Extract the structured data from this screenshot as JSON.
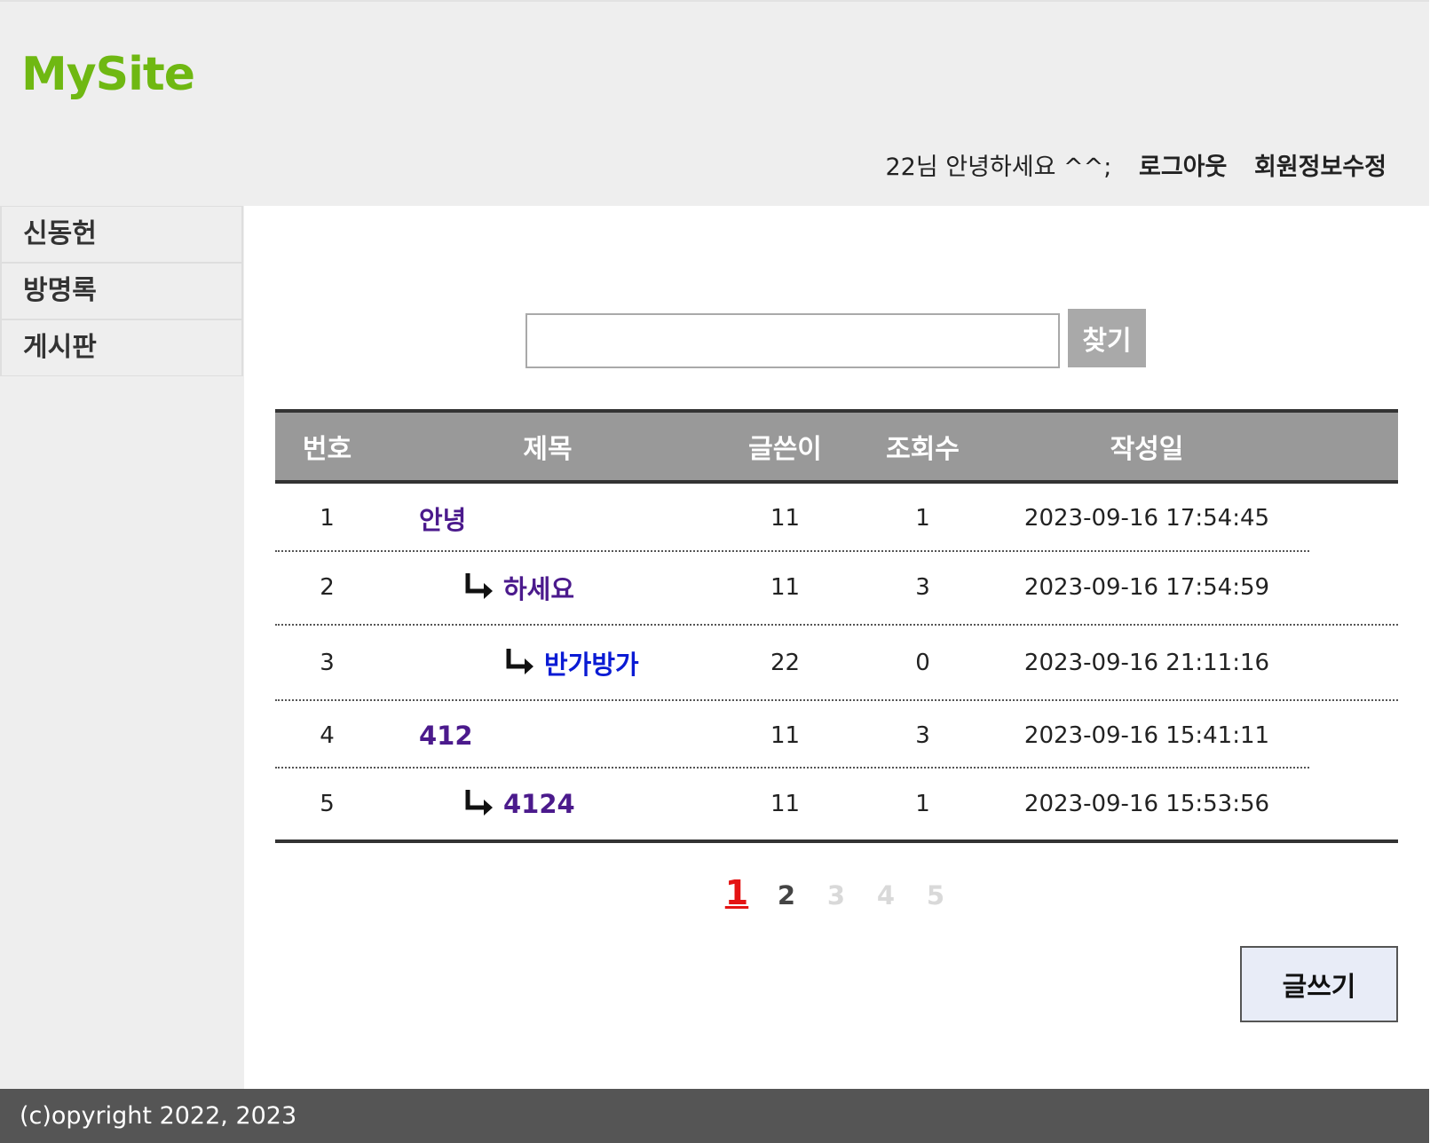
{
  "header": {
    "logo": "MySite",
    "greeting": "22님 안녕하세요 ^^;",
    "logout_label": "로그아웃",
    "edit_profile_label": "회원정보수정"
  },
  "sidebar": {
    "items": [
      {
        "label": "신동헌"
      },
      {
        "label": "방명록"
      },
      {
        "label": "게시판"
      }
    ]
  },
  "search": {
    "value": "",
    "button_label": "찾기"
  },
  "board": {
    "columns": [
      "번호",
      "제목",
      "글쓴이",
      "조회수",
      "작성일"
    ],
    "rows": [
      {
        "no": "1",
        "title": "안녕",
        "depth": 0,
        "writer": "11",
        "hits": "1",
        "date": "2023-09-16 17:54:45",
        "visited": true
      },
      {
        "no": "2",
        "title": "하세요",
        "depth": 1,
        "writer": "11",
        "hits": "3",
        "date": "2023-09-16 17:54:59",
        "visited": true
      },
      {
        "no": "3",
        "title": "반가방가",
        "depth": 2,
        "writer": "22",
        "hits": "0",
        "date": "2023-09-16 21:11:16",
        "visited": false
      },
      {
        "no": "4",
        "title": "412",
        "depth": 0,
        "writer": "11",
        "hits": "3",
        "date": "2023-09-16 15:41:11",
        "visited": true
      },
      {
        "no": "5",
        "title": "4124",
        "depth": 1,
        "writer": "11",
        "hits": "1",
        "date": "2023-09-16 15:53:56",
        "visited": true
      }
    ],
    "reply_icon": "reply-arrow-icon"
  },
  "pagination": {
    "pages": [
      "1",
      "2",
      "3",
      "4",
      "5"
    ],
    "current": "1"
  },
  "write_button_label": "글쓰기",
  "footer": {
    "copyright": "(c)opyright 2022, 2023"
  },
  "colors": {
    "logo": "#6fb812",
    "header_bg": "#eeeeee",
    "table_header_bg": "#999999",
    "current_page": "#e41414",
    "visited_link": "#4b1a8c",
    "new_link": "#0a1bd4",
    "footer_bg": "#555555"
  }
}
